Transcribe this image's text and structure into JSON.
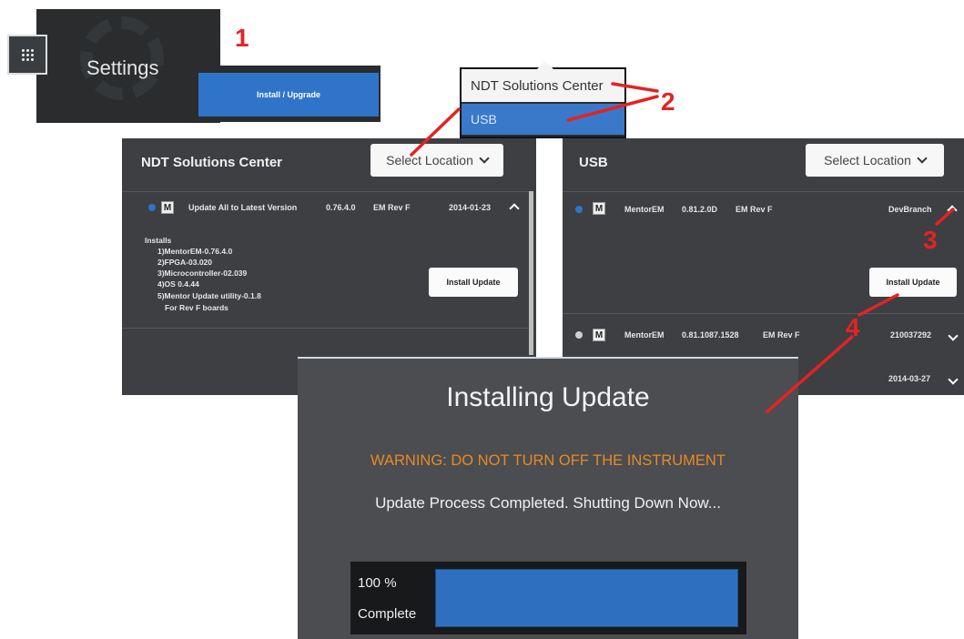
{
  "settings": {
    "label": "Settings"
  },
  "install_upgrade": {
    "label": "Install / Upgrade"
  },
  "dropdown": {
    "options": [
      "NDT Solutions Center",
      "USB"
    ],
    "selected": "USB"
  },
  "left_panel": {
    "title": "NDT Solutions Center",
    "select_location": "Select Location",
    "row": {
      "name": "Update All to Latest Version",
      "version": "0.76.4.0",
      "rev": "EM Rev F",
      "date": "2014-01-23"
    },
    "installs_heading": "Installs",
    "installs": [
      "1)MentorEM-0.76.4.0",
      "2)FPGA-03.020",
      "3)Microcontroller-02.039",
      "4)OS 0.4.44",
      "5)Mentor Update utility-0.1.8",
      "For Rev F boards"
    ],
    "install_button": "Install Update"
  },
  "right_panel": {
    "title": "USB",
    "select_location": "Select Location",
    "rows": [
      {
        "name": "MentorEM",
        "version": "0.81.2.0D",
        "rev": "EM Rev F",
        "date": "DevBranch"
      },
      {
        "name": "MentorEM",
        "version": "0.81.1087.1528",
        "rev": "EM Rev F",
        "date": "210037292"
      },
      {
        "date": "2014-03-27"
      }
    ],
    "install_button": "Install Update"
  },
  "dialog": {
    "title": "Installing Update",
    "warning": "WARNING: DO NOT TURN OFF THE INSTRUMENT",
    "status": "Update Process Completed. Shutting Down Now...",
    "progress_text": "100 %",
    "progress_label": "Complete",
    "progress": 1.0
  },
  "callouts": [
    "1",
    "2",
    "3",
    "4"
  ],
  "colors": {
    "accent_blue": "#2f74c8",
    "warning_orange": "#e68a27",
    "callout_red": "#e32323"
  }
}
